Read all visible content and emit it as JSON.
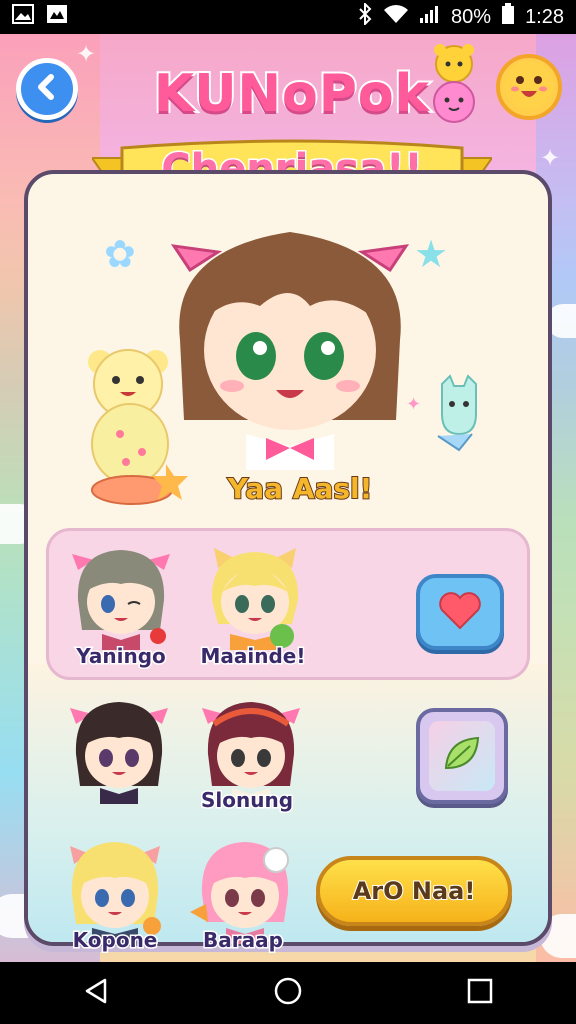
{
  "status_bar": {
    "battery": "80%",
    "time": "1:28",
    "icons": [
      "image-icon",
      "gallery-icon",
      "bluetooth-icon",
      "wifi-icon",
      "signal-icon",
      "battery-icon"
    ]
  },
  "header": {
    "title_line1": "KUNoPok",
    "title_line2": "Chenriasa!!",
    "back_icon": "chevron-left-icon",
    "face_icon": "smiley-face-icon"
  },
  "hero": {
    "caption": "Yaa Aasl!"
  },
  "characters": [
    {
      "label": "Yaningo"
    },
    {
      "label": "Maainde!"
    },
    {
      "label": ""
    },
    {
      "label": "Slonung"
    },
    {
      "label": "Kopone"
    },
    {
      "label": "Baraap"
    }
  ],
  "actions": {
    "heart_icon": "heart-icon",
    "leaf_icon": "leaf-icon",
    "cta_label": "ArO Naa!"
  },
  "colors": {
    "accent_pink": "#ff5a9a",
    "accent_yellow": "#ffd02e",
    "accent_blue": "#4ab0ff",
    "button_blue": "#6ec2f4",
    "cta_yellow": "#f6b21a",
    "panel_cream": "#fdf6e6"
  },
  "nav": {
    "back_icon": "nav-back-icon",
    "home_icon": "nav-home-icon",
    "recents_icon": "nav-recents-icon"
  }
}
